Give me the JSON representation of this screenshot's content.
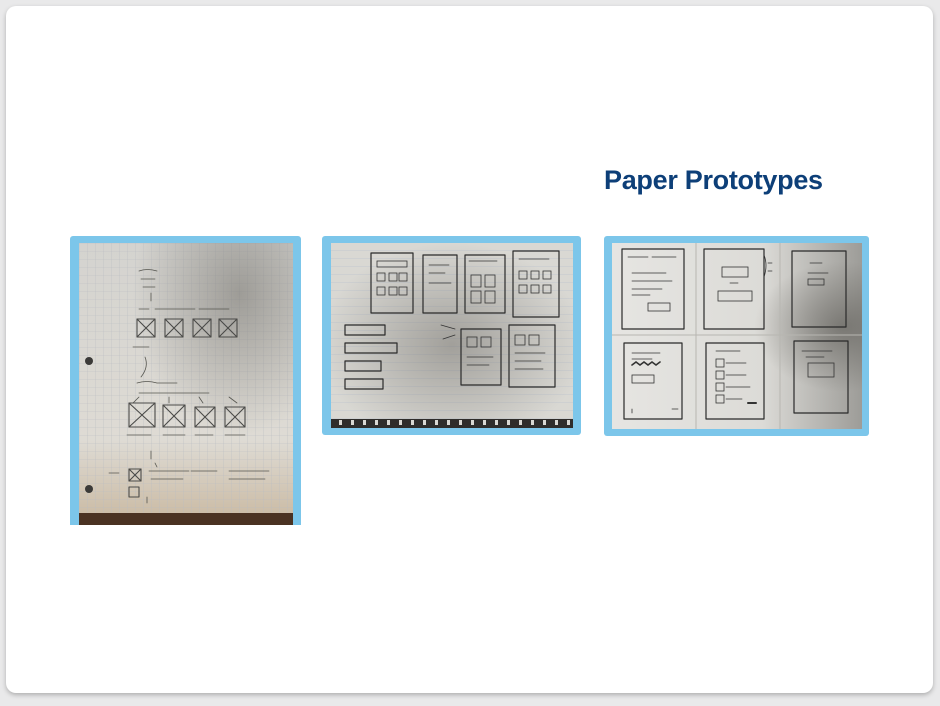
{
  "slide": {
    "title": "Paper Prototypes"
  },
  "photos": [
    {
      "icon": "graph-paper-sketch-photo"
    },
    {
      "icon": "lined-notebook-sketch-photo"
    },
    {
      "icon": "folded-paper-prototype-photo"
    }
  ],
  "colors": {
    "title": "#0d3f78",
    "frame": "#7cc6ea",
    "slide_background": "#ffffff"
  }
}
